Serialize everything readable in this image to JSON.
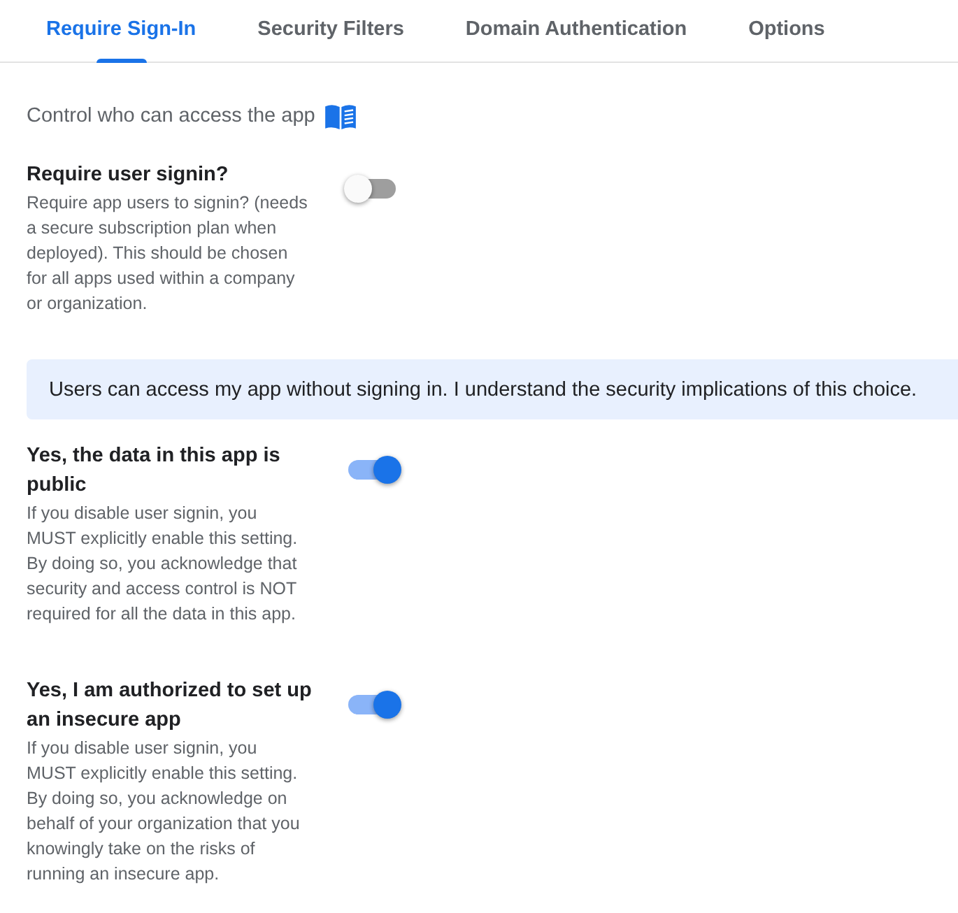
{
  "tabs": [
    {
      "label": "Require Sign-In",
      "selected": true
    },
    {
      "label": "Security Filters",
      "selected": false
    },
    {
      "label": "Domain Authentication",
      "selected": false
    },
    {
      "label": "Options",
      "selected": false
    }
  ],
  "intro": {
    "text": "Control who can access the app"
  },
  "items": [
    {
      "kind": "toggle",
      "title": "Require user signin?",
      "description": "Require app users to signin? (needs a secure subscription plan when deployed). This should be chosen for all apps used within a company or organization.",
      "on": false
    },
    {
      "kind": "notice",
      "text": "Users can access my app without signing in. I understand the security implications of this choice."
    },
    {
      "kind": "toggle",
      "title": "Yes, the data in this app is public",
      "description": "If you disable user signin, you MUST explicitly enable this setting. By doing so, you acknowledge that security and access control is NOT required for all the data in this app.",
      "on": true
    },
    {
      "kind": "toggle",
      "title": "Yes, I am authorized to set up an insecure app",
      "description": "If you disable user signin, you MUST explicitly enable this setting. By doing so, you acknowledge on behalf of your organization that you knowingly take on the risks of running an insecure app.",
      "on": true
    }
  ]
}
